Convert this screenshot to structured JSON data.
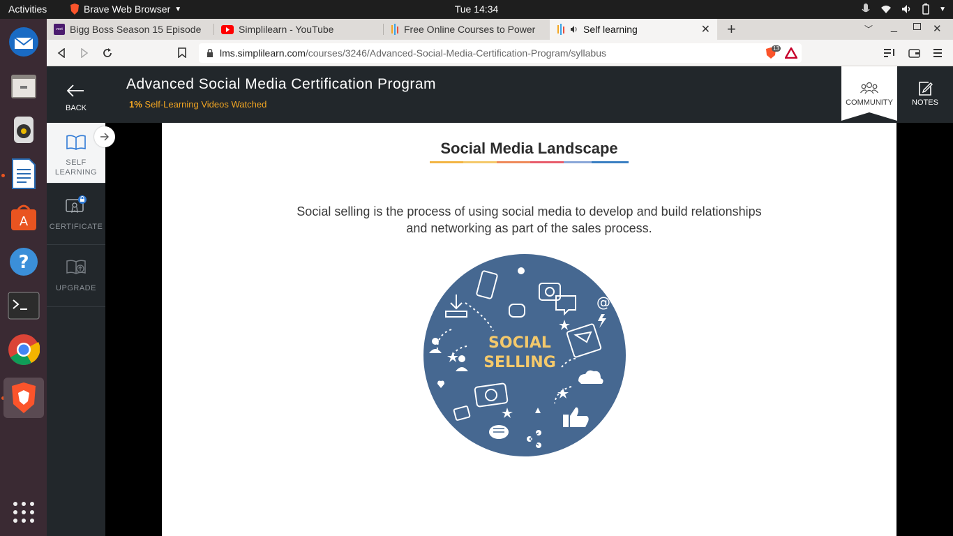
{
  "system": {
    "activities": "Activities",
    "app_name": "Brave Web Browser",
    "clock": "Tue 14:34"
  },
  "tabs": [
    {
      "label": "Bigg Boss Season 15 Episode",
      "favicon": "voot"
    },
    {
      "label": "Simplilearn - YouTube"
    },
    {
      "label": "Free Online Courses to Power"
    },
    {
      "label": "Self learning"
    }
  ],
  "url": {
    "domain": "lms.simplilearn.com",
    "path": "/courses/3246/Advanced-Social-Media-Certification-Program/syllabus"
  },
  "brave_badge": "13",
  "header": {
    "back_label": "BACK",
    "title": "Advanced Social Media Certification Program",
    "progress_value": "1%",
    "progress_text": "Self-Learning Videos Watched",
    "community_label": "COMMUNITY",
    "notes_label": "NOTES"
  },
  "sidebar": {
    "items": [
      {
        "label_line1": "SELF",
        "label_line2": "LEARNING"
      },
      {
        "label_line1": "CERTIFICATE"
      },
      {
        "label_line1": "UPGRADE"
      }
    ]
  },
  "slide": {
    "title": "Social Media Landscape",
    "text_line1": "Social selling is the process of using social media to develop and build relationships",
    "text_line2": "and networking as part of the sales process.",
    "circle_line1": "SOCIAL",
    "circle_line2": "SELLING"
  },
  "colors": {
    "accent_orange": "#f2a623",
    "circle_blue": "#466891",
    "header_dark": "#22272b"
  }
}
